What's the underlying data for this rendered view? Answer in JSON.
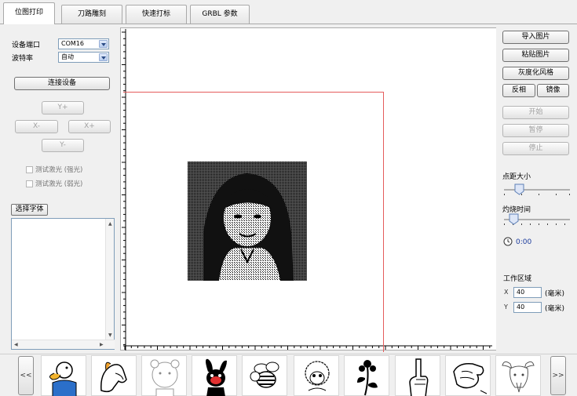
{
  "tabs": [
    "位图打印",
    "刀路雕刻",
    "快速打标",
    "GRBL 参数"
  ],
  "left": {
    "port_label": "设备端口",
    "port_value": "COM16",
    "baud_label": "波特率",
    "baud_value": "自动",
    "connect": "连接设备",
    "y_plus": "Y+",
    "x_minus": "X-",
    "x_plus": "X+",
    "y_minus": "Y-",
    "test_strong": "测试激光 (强光)",
    "test_weak": "测试激光 (弱光)",
    "choose_font": "选择字体"
  },
  "right": {
    "import": "导入图片",
    "paste": "粘贴图片",
    "gray": "灰度化风格",
    "invert": "反相",
    "mirror": "镜像",
    "start": "开始",
    "pause": "暂停",
    "stop": "停止",
    "dot_size": "点距大小",
    "burn_time": "灼烧时间",
    "timer": "0:00",
    "work_area": "工作区域",
    "x_label": "X",
    "y_label": "Y",
    "x_value": "40",
    "y_value": "40",
    "unit": "(毫米)"
  },
  "strip": {
    "prev": "<<",
    "next": ">>",
    "thumbnails": [
      "duck",
      "horse",
      "bear",
      "rabbit",
      "bee",
      "sheep",
      "flower",
      "hand",
      "fist",
      "goat"
    ]
  },
  "colors": {
    "work_area_border": "#e55c5c",
    "input_border": "#7f9db9"
  }
}
